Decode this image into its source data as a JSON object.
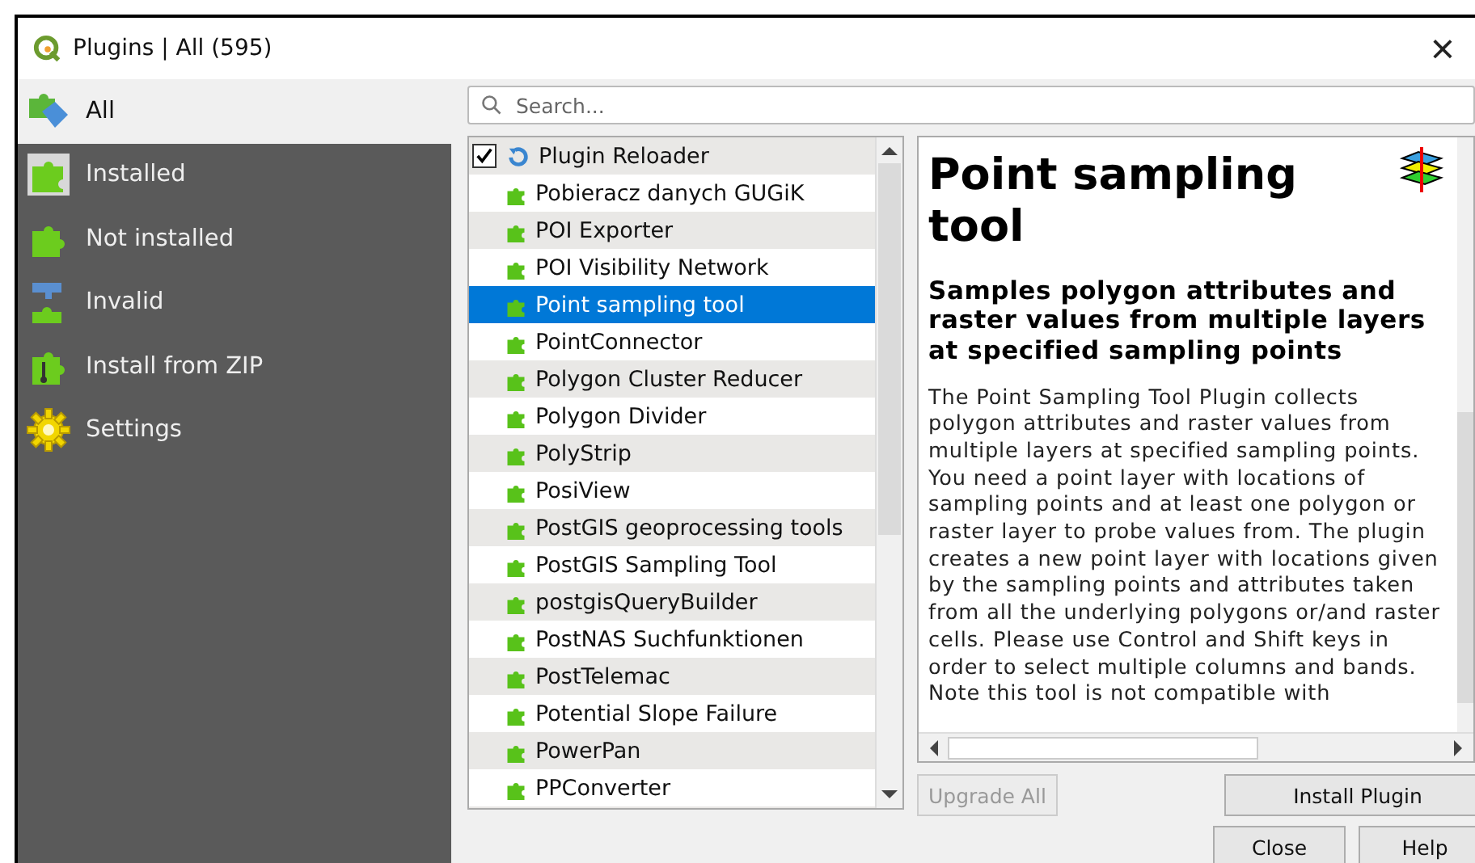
{
  "window": {
    "title": "Plugins | All (595)",
    "close": "×"
  },
  "sidebar": {
    "items": [
      {
        "label": "All",
        "selected": true
      },
      {
        "label": "Installed",
        "selected": false
      },
      {
        "label": "Not installed",
        "selected": false
      },
      {
        "label": "Invalid",
        "selected": false
      },
      {
        "label": "Install from ZIP",
        "selected": false
      },
      {
        "label": "Settings",
        "selected": false
      }
    ]
  },
  "search": {
    "placeholder": "Search..."
  },
  "plugins": [
    {
      "name": "Plugin Reloader",
      "kind": "installed",
      "checked": true,
      "selected": false
    },
    {
      "name": "Pobieracz danych GUGiK",
      "kind": "available",
      "selected": false
    },
    {
      "name": "POI Exporter",
      "kind": "available",
      "selected": false
    },
    {
      "name": "POI Visibility Network",
      "kind": "available",
      "selected": false
    },
    {
      "name": "Point sampling tool",
      "kind": "available",
      "selected": true
    },
    {
      "name": "PointConnector",
      "kind": "available",
      "selected": false
    },
    {
      "name": "Polygon Cluster Reducer",
      "kind": "available",
      "selected": false
    },
    {
      "name": "Polygon Divider",
      "kind": "available",
      "selected": false
    },
    {
      "name": "PolyStrip",
      "kind": "available",
      "selected": false
    },
    {
      "name": "PosiView",
      "kind": "available",
      "selected": false
    },
    {
      "name": "PostGIS geoprocessing tools",
      "kind": "available",
      "selected": false
    },
    {
      "name": "PostGIS Sampling Tool",
      "kind": "available",
      "selected": false
    },
    {
      "name": "postgisQueryBuilder",
      "kind": "available",
      "selected": false
    },
    {
      "name": "PostNAS Suchfunktionen",
      "kind": "available",
      "selected": false
    },
    {
      "name": "PostTelemac",
      "kind": "available",
      "selected": false
    },
    {
      "name": "Potential Slope Failure",
      "kind": "available",
      "selected": false
    },
    {
      "name": "PowerPan",
      "kind": "available",
      "selected": false
    },
    {
      "name": "PPConverter",
      "kind": "available",
      "selected": false
    }
  ],
  "details": {
    "title": "Point sampling tool",
    "summary": "Samples polygon attributes and raster values from multiple layers at specified sampling points",
    "description": "The Point Sampling Tool Plugin collects polygon attributes and raster values from multiple layers at specified sampling points. You need a point layer with locations of sampling points and at least one polygon or raster layer to probe values from. The plugin creates a new point layer with locations given by the sampling points and attributes taken from all the underlying polygons or/and raster cells. Please use Control and Shift keys in order to select multiple columns and bands. Note this tool is not compatible with"
  },
  "buttons": {
    "upgrade_all": {
      "label": "Upgrade All",
      "disabled": true
    },
    "install": "Install Plugin",
    "close": "Close",
    "help": "Help"
  }
}
